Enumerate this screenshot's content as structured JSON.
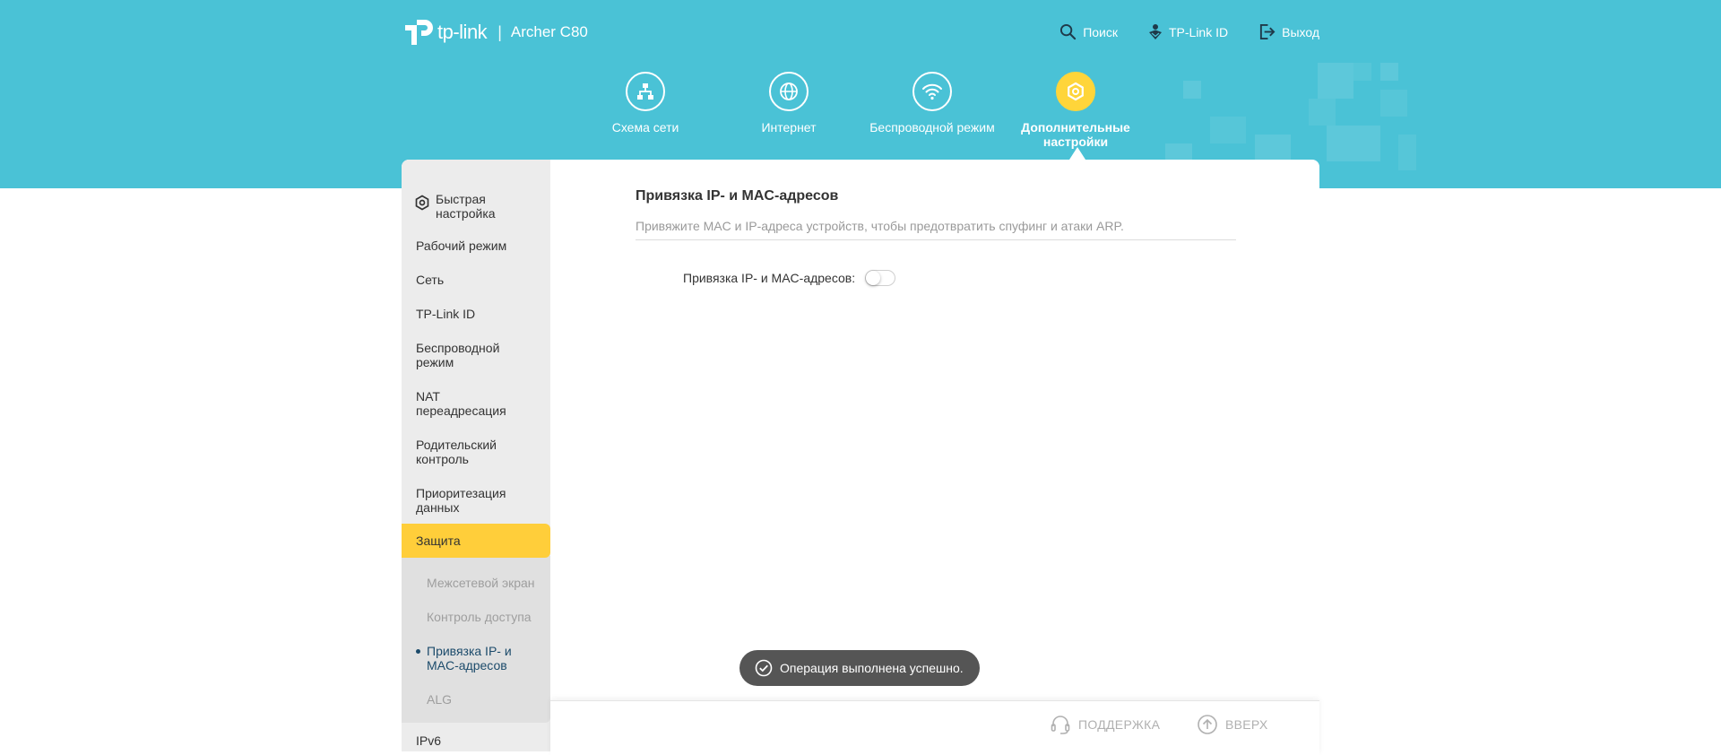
{
  "header": {
    "brand": "tp-link",
    "separator": "|",
    "model": "Archer C80",
    "nav": [
      {
        "label": "Поиск",
        "icon": "search-icon"
      },
      {
        "label": "TP-Link ID",
        "icon": "tplink-id-icon"
      },
      {
        "label": "Выход",
        "icon": "logout-icon"
      }
    ]
  },
  "modules": [
    {
      "label": "Схема сети",
      "icon": "network-map-icon"
    },
    {
      "label": "Интернет",
      "icon": "globe-icon"
    },
    {
      "label": "Беспроводной режим",
      "icon": "wifi-icon"
    },
    {
      "label": "Дополнительные настройки",
      "icon": "gear-icon",
      "active": true
    }
  ],
  "sidebar": {
    "items": [
      {
        "label": "Быстрая настройка",
        "icon": "quick-setup-icon"
      },
      {
        "label": "Рабочий режим"
      },
      {
        "label": "Сеть"
      },
      {
        "label": "TP-Link ID"
      },
      {
        "label": "Беспроводной режим"
      },
      {
        "label": "NAT переадресация"
      },
      {
        "label": "Родительский контроль"
      },
      {
        "label": "Приоритезация данных"
      },
      {
        "label": "Защита",
        "active": true
      },
      {
        "label": "IPv6"
      }
    ],
    "subitems": [
      {
        "label": "Межсетевой экран"
      },
      {
        "label": "Контроль доступа"
      },
      {
        "label": "Привязка IP- и MAC-адресов",
        "current": true
      },
      {
        "label": "ALG"
      }
    ]
  },
  "content": {
    "title": "Привязка IP- и MAC-адресов",
    "description": "Привяжите MAC и IP-адреса устройств, чтобы предотвратить спуфинг и атаки ARP.",
    "toggle_label": "Привязка IP- и MAC-адресов:",
    "toggle_on": false
  },
  "toast": {
    "text": "Операция выполнена успешно.",
    "icon": "check-circle-icon"
  },
  "footer": {
    "support": "ПОДДЕРЖКА",
    "top": "ВВЕРХ"
  },
  "colors": {
    "banner": "#4ac2d6",
    "accent": "#ffce3a",
    "sidebar": "#ececec"
  }
}
